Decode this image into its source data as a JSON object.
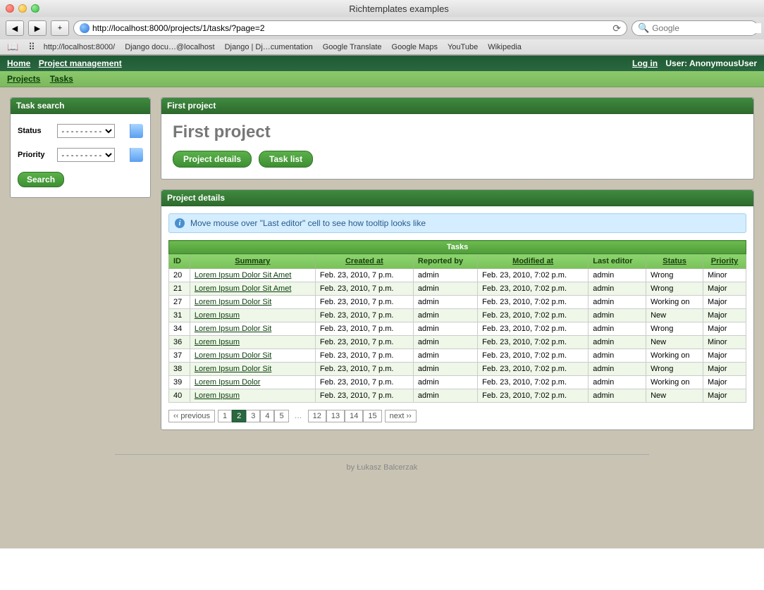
{
  "window_title": "Richtemplates examples",
  "url": "http://localhost:8000/projects/1/tasks/?page=2",
  "search_placeholder": "Google",
  "bookmarks": [
    "http://localhost:8000/",
    "Django docu…@localhost",
    "Django | Dj…cumentation",
    "Google Translate",
    "Google Maps",
    "YouTube",
    "Wikipedia"
  ],
  "topnav": {
    "home": "Home",
    "project_mgmt": "Project management",
    "login": "Log in",
    "user_prefix": "User:",
    "user": "AnonymousUser"
  },
  "subnav": {
    "projects": "Projects",
    "tasks": "Tasks"
  },
  "sidebar": {
    "title": "Task search",
    "status_label": "Status",
    "priority_label": "Priority",
    "placeholder": "---------",
    "search_btn": "Search"
  },
  "project_panel": {
    "head": "First project",
    "title": "First project",
    "btn_details": "Project details",
    "btn_tasklist": "Task list"
  },
  "details_panel": {
    "head": "Project details",
    "info": "Move mouse over \"Last editor\" cell to see how tooltip looks like",
    "table_caption": "Tasks",
    "columns": {
      "id": "ID",
      "summary": "Summary",
      "created": "Created at",
      "reported": "Reported by",
      "modified": "Modified at",
      "editor": "Last editor",
      "status": "Status",
      "priority": "Priority"
    },
    "rows": [
      {
        "id": "20",
        "summary": "Lorem Ipsum Dolor Sit Amet",
        "created": "Feb. 23, 2010, 7 p.m.",
        "reported": "admin",
        "modified": "Feb. 23, 2010, 7:02 p.m.",
        "editor": "admin",
        "status": "Wrong",
        "priority": "Minor"
      },
      {
        "id": "21",
        "summary": "Lorem Ipsum Dolor Sit Amet",
        "created": "Feb. 23, 2010, 7 p.m.",
        "reported": "admin",
        "modified": "Feb. 23, 2010, 7:02 p.m.",
        "editor": "admin",
        "status": "Wrong",
        "priority": "Major"
      },
      {
        "id": "27",
        "summary": "Lorem Ipsum Dolor Sit",
        "created": "Feb. 23, 2010, 7 p.m.",
        "reported": "admin",
        "modified": "Feb. 23, 2010, 7:02 p.m.",
        "editor": "admin",
        "status": "Working on",
        "priority": "Major"
      },
      {
        "id": "31",
        "summary": "Lorem Ipsum",
        "created": "Feb. 23, 2010, 7 p.m.",
        "reported": "admin",
        "modified": "Feb. 23, 2010, 7:02 p.m.",
        "editor": "admin",
        "status": "New",
        "priority": "Major"
      },
      {
        "id": "34",
        "summary": "Lorem Ipsum Dolor Sit",
        "created": "Feb. 23, 2010, 7 p.m.",
        "reported": "admin",
        "modified": "Feb. 23, 2010, 7:02 p.m.",
        "editor": "admin",
        "status": "Wrong",
        "priority": "Major"
      },
      {
        "id": "36",
        "summary": "Lorem Ipsum",
        "created": "Feb. 23, 2010, 7 p.m.",
        "reported": "admin",
        "modified": "Feb. 23, 2010, 7:02 p.m.",
        "editor": "admin",
        "status": "New",
        "priority": "Minor"
      },
      {
        "id": "37",
        "summary": "Lorem Ipsum Dolor Sit",
        "created": "Feb. 23, 2010, 7 p.m.",
        "reported": "admin",
        "modified": "Feb. 23, 2010, 7:02 p.m.",
        "editor": "admin",
        "status": "Working on",
        "priority": "Major"
      },
      {
        "id": "38",
        "summary": "Lorem Ipsum Dolor Sit",
        "created": "Feb. 23, 2010, 7 p.m.",
        "reported": "admin",
        "modified": "Feb. 23, 2010, 7:02 p.m.",
        "editor": "admin",
        "status": "Wrong",
        "priority": "Major"
      },
      {
        "id": "39",
        "summary": "Lorem Ipsum Dolor",
        "created": "Feb. 23, 2010, 7 p.m.",
        "reported": "admin",
        "modified": "Feb. 23, 2010, 7:02 p.m.",
        "editor": "admin",
        "status": "Working on",
        "priority": "Major"
      },
      {
        "id": "40",
        "summary": "Lorem Ipsum",
        "created": "Feb. 23, 2010, 7 p.m.",
        "reported": "admin",
        "modified": "Feb. 23, 2010, 7:02 p.m.",
        "editor": "admin",
        "status": "New",
        "priority": "Major"
      }
    ]
  },
  "pagination": {
    "prev": "‹‹ previous",
    "pages_a": [
      "1",
      "2",
      "3",
      "4",
      "5"
    ],
    "pages_b": [
      "12",
      "13",
      "14",
      "15"
    ],
    "current": "2",
    "next": "next ››"
  },
  "footer": "by Łukasz Balcerzak"
}
